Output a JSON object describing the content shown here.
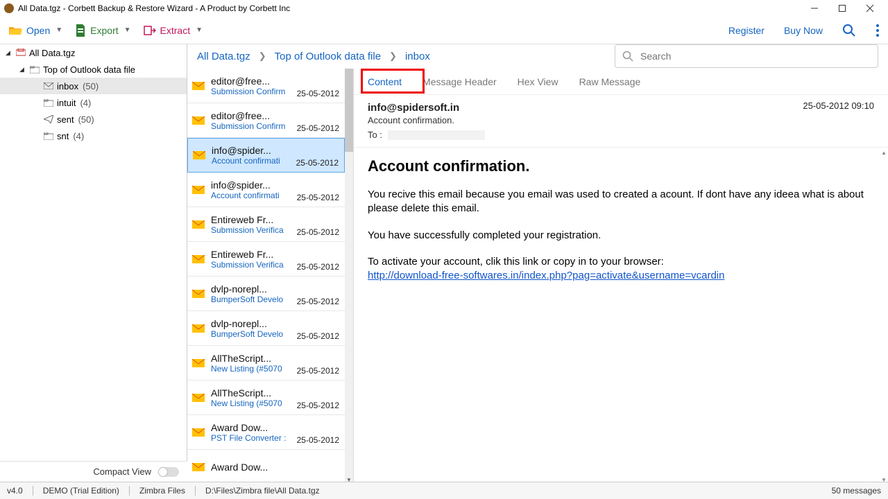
{
  "title": "All Data.tgz - Corbett Backup & Restore Wizard - A Product by Corbett Inc",
  "toolbar": {
    "open": "Open",
    "export": "Export",
    "extract": "Extract",
    "register": "Register",
    "buy": "Buy Now"
  },
  "breadcrumb": [
    "All Data.tgz",
    "Top of Outlook data file",
    "inbox"
  ],
  "search_placeholder": "Search",
  "tree": {
    "root": "All Data.tgz",
    "top": "Top of Outlook data file",
    "items": [
      {
        "label": "inbox",
        "count": "(50)",
        "selected": true,
        "icon": "envelope"
      },
      {
        "label": "intuit",
        "count": "(4)",
        "icon": "folder"
      },
      {
        "label": "sent",
        "count": "(50)",
        "icon": "sent"
      },
      {
        "label": "snt",
        "count": "(4)",
        "icon": "folder"
      }
    ]
  },
  "compact_label": "Compact View",
  "list": [
    {
      "from": "editor@free...",
      "subject": "Submission Confirm",
      "date": "25-05-2012"
    },
    {
      "from": "editor@free...",
      "subject": "Submission Confirm",
      "date": "25-05-2012"
    },
    {
      "from": "info@spider...",
      "subject": "Account confirmati",
      "date": "25-05-2012",
      "selected": true
    },
    {
      "from": "info@spider...",
      "subject": "Account confirmati",
      "date": "25-05-2012"
    },
    {
      "from": "Entireweb Fr...",
      "subject": "Submission Verifica",
      "date": "25-05-2012"
    },
    {
      "from": "Entireweb Fr...",
      "subject": "Submission Verifica",
      "date": "25-05-2012"
    },
    {
      "from": "dvlp-norepl...",
      "subject": "BumperSoft Develo",
      "date": "25-05-2012"
    },
    {
      "from": "dvlp-norepl...",
      "subject": "BumperSoft Develo",
      "date": "25-05-2012"
    },
    {
      "from": "AllTheScript...",
      "subject": "New Listing (#5070",
      "date": "25-05-2012"
    },
    {
      "from": "AllTheScript...",
      "subject": "New Listing (#5070",
      "date": "25-05-2012"
    },
    {
      "from": "Award Dow...",
      "subject": "PST File Converter :",
      "date": "25-05-2012"
    },
    {
      "from": "Award Dow...",
      "subject": "",
      "date": ""
    }
  ],
  "tabs": [
    "Content",
    "Message Header",
    "Hex View",
    "Raw Message"
  ],
  "message": {
    "from": "info@spidersoft.in",
    "datetime": "25-05-2012 09:10",
    "subject": "Account confirmation.",
    "to_label": "To :",
    "body": {
      "heading": "Account confirmation.",
      "p1": "You recive this email because you email was used to created a acount. If dont have any ideea what is about please delete this email.",
      "p2": "You have successfully completed your registration.",
      "p3": "To activate your account, clik this link or copy in to your browser:",
      "link": "http://download-free-softwares.in/index.php?pag=activate&username=vcardin"
    }
  },
  "status": {
    "version": "v4.0",
    "edition": "DEMO (Trial Edition)",
    "mode": "Zimbra Files",
    "path": "D:\\Files\\Zimbra file\\All Data.tgz",
    "count": "50  messages"
  }
}
